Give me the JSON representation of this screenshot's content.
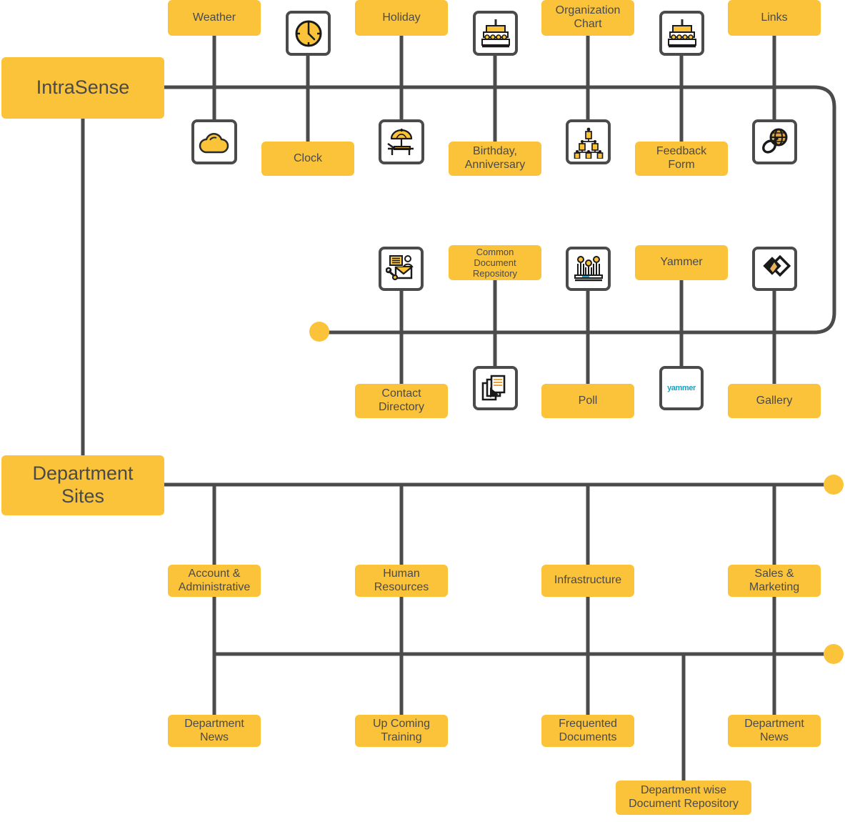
{
  "diagram": {
    "title": "IntraSense Intranet Site Map",
    "accent_color": "#FBC33A",
    "line_color": "#4b4b4b",
    "text_color": "#4a4a4a"
  },
  "roots": [
    {
      "id": "intrasense",
      "label": "IntraSense"
    },
    {
      "id": "department_sites",
      "label": "Department Sites"
    }
  ],
  "intrasense_features": [
    {
      "id": "weather",
      "label": "Weather",
      "icon": "cloud-icon"
    },
    {
      "id": "clock",
      "label": "Clock",
      "icon": "clock-icon"
    },
    {
      "id": "holiday",
      "label": "Holiday",
      "icon": "beach-umbrella-icon"
    },
    {
      "id": "birthday",
      "label": "Birthday, Anniversary",
      "icon": "birthday-cake-icon"
    },
    {
      "id": "org_chart",
      "label": "Organization Chart",
      "icon": "org-chart-icon"
    },
    {
      "id": "feedback_form",
      "label": "Feedback Form",
      "icon": "birthday-cake-icon"
    },
    {
      "id": "links",
      "label": "Links",
      "icon": "globe-link-icon"
    },
    {
      "id": "contact_dir",
      "label": "Contact Directory",
      "icon": "contact-card-icon"
    },
    {
      "id": "common_docs",
      "label": "Common Document Repository",
      "icon": "documents-icon"
    },
    {
      "id": "poll",
      "label": "Poll",
      "icon": "poll-people-icon"
    },
    {
      "id": "yammer",
      "label": "Yammer",
      "icon": "yammer-logo-icon"
    },
    {
      "id": "gallery",
      "label": "Gallery",
      "icon": "gallery-diamond-icon"
    }
  ],
  "department_sites": [
    {
      "id": "account_admin",
      "label": "Account & Administrative"
    },
    {
      "id": "human_resources",
      "label": "Human Resources"
    },
    {
      "id": "infrastructure",
      "label": "Infrastructure"
    },
    {
      "id": "sales_marketing",
      "label": "Sales & Marketing"
    }
  ],
  "department_features": [
    {
      "id": "dept_news_1",
      "label": "Department News"
    },
    {
      "id": "upcoming_train",
      "label": "Up Coming Training"
    },
    {
      "id": "freq_docs",
      "label": "Frequented Documents"
    },
    {
      "id": "dept_news_2",
      "label": "Department News"
    },
    {
      "id": "dept_doc_repo",
      "label": "Department wise Document Repository"
    }
  ],
  "labels": {
    "weather": "Weather",
    "clock": "Clock",
    "holiday": "Holiday",
    "birthday": "Birthday,\nAnniversary",
    "birthday_l1": "Birthday,",
    "birthday_l2": "Anniversary",
    "org_chart_l1": "Organization",
    "org_chart_l2": "Chart",
    "feedback_l1": "Feedback",
    "feedback_l2": "Form",
    "links": "Links",
    "contact_l1": "Contact",
    "contact_l2": "Directory",
    "common_docs_l1": "Common Document",
    "common_docs_l2": "Repository",
    "poll": "Poll",
    "yammer": "Yammer",
    "gallery": "Gallery",
    "intrasense": "IntraSense",
    "dept_sites_l1": "Department",
    "dept_sites_l2": "Sites",
    "acct_l1": "Account &",
    "acct_l2": "Administrative",
    "hr_l1": "Human",
    "hr_l2": "Resources",
    "infra": "Infrastructure",
    "sales_l1": "Sales &",
    "sales_l2": "Marketing",
    "deptnews_l1": "Department",
    "deptnews_l2": "News",
    "upcoming_l1": "Up Coming",
    "upcoming_l2": "Training",
    "freq_l1": "Frequented",
    "freq_l2": "Documents",
    "deptnews2_l1": "Department",
    "deptnews2_l2": "News",
    "deptrepo_l1": "Department wise",
    "deptrepo_l2": "Document Repository",
    "yammer_logo": "yammer"
  }
}
